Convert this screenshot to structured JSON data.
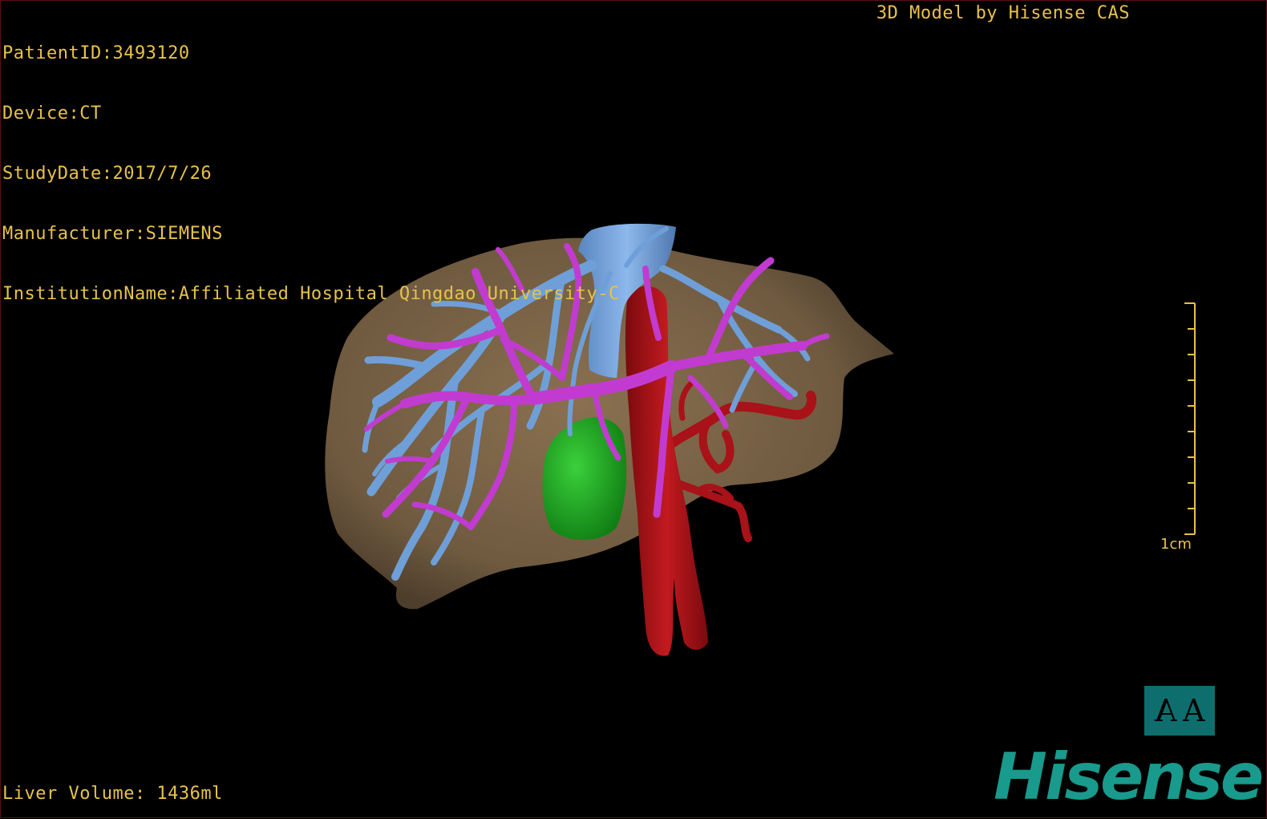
{
  "dicom_info": {
    "patient_id": "PatientID:3493120",
    "device": "Device:CT",
    "study_date": "StudyDate:2017/7/26",
    "manufacturer": "Manufacturer:SIEMENS",
    "institution": "InstitutionName:Affiliated Hospital Qingdao University-C"
  },
  "model_credit": "3D Model by Hisense CAS",
  "liver_volume": "Liver Volume: 1436ml",
  "scale_bar": {
    "label": "1cm"
  },
  "orientation_cube": {
    "left_glyph": "A",
    "right_glyph": "A"
  },
  "brand": "Hisense",
  "colors": {
    "overlay_text": "#e8c24a",
    "liver": "#7d6446",
    "hepatic_vein": "#6f9fd8",
    "portal_vein": "#c23bd0",
    "artery": "#b0141a",
    "gallbladder": "#1fa01f",
    "brand": "#189a8c"
  },
  "icons": {
    "orientation": "orientation-cube-icon",
    "scale": "scale-bar-icon"
  }
}
